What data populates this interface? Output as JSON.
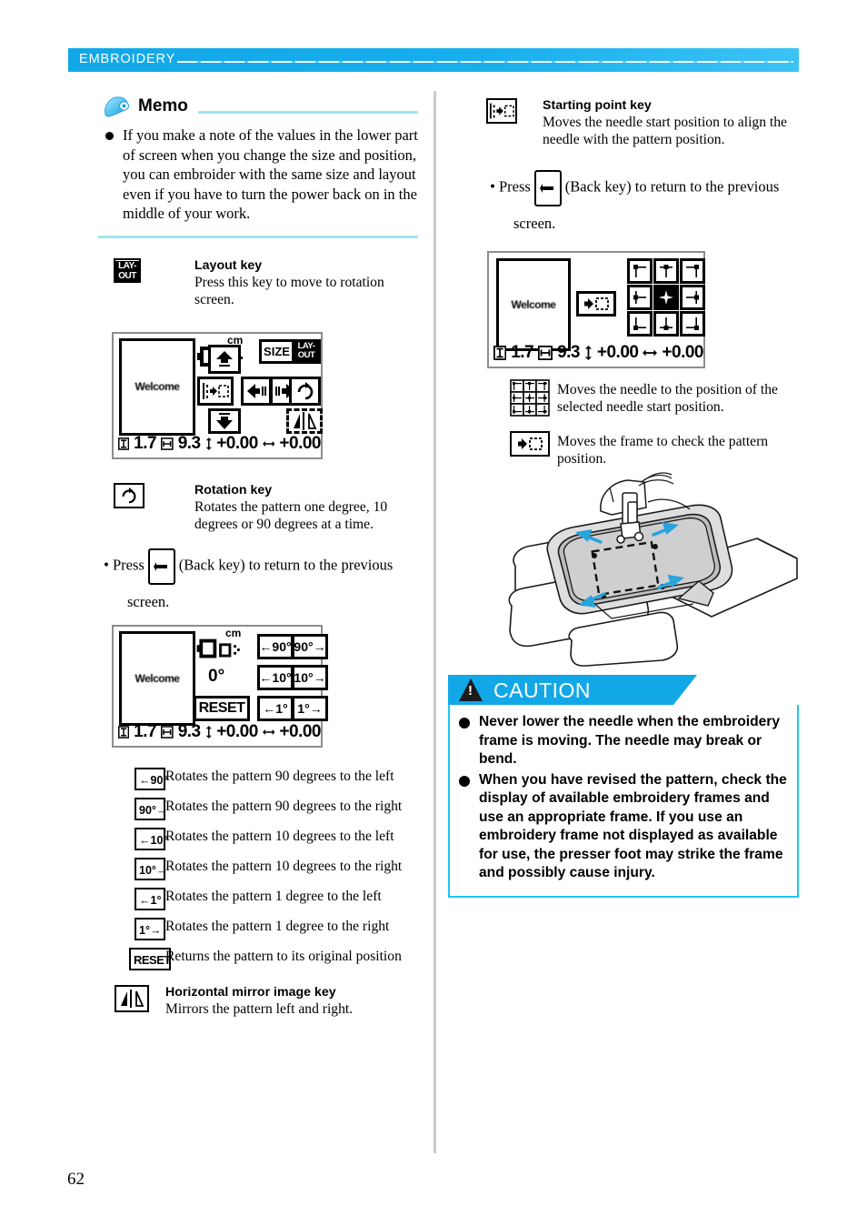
{
  "header": {
    "section_label": "EMBROIDERY",
    "accent_color": "#12A8E8"
  },
  "page_number": "62",
  "left_column": {
    "memo": {
      "title": "Memo",
      "icon": "memo-bell-icon",
      "bullets": [
        "If you make a note of the values in the lower part of screen when you change the size and position, you can embroider with the same size and layout even if you have to turn the power back on in the middle of your work."
      ]
    },
    "layout_key": {
      "icon_label_top": "LAY-",
      "icon_label_bottom": "OUT",
      "title": "Layout key",
      "description": "Press this key to move to rotation screen."
    },
    "lcd_layout_screen": {
      "preview_text": "Welcome",
      "unit_label": "cm",
      "keys": [
        {
          "name": "size-key",
          "label": "SIZE"
        },
        {
          "name": "layout-key",
          "label": "LAY-OUT"
        },
        {
          "name": "up-arrow-key",
          "label": "▲"
        },
        {
          "name": "starting-point-key",
          "label": ""
        },
        {
          "name": "left-arrow-key",
          "label": "◀"
        },
        {
          "name": "right-arrow-key",
          "label": "▶"
        },
        {
          "name": "rotation-key",
          "label": ""
        },
        {
          "name": "down-arrow-key",
          "label": "▼"
        },
        {
          "name": "mirror-key",
          "label": ""
        }
      ],
      "status": {
        "height_value": "1.7",
        "width_value": "9.3",
        "vertical_offset": "+0.00",
        "horizontal_offset": "+0.00"
      }
    },
    "rotation_key": {
      "title": "Rotation key",
      "description": "Rotates the pattern one degree, 10 degrees or 90 degrees at a time."
    },
    "press_back": {
      "before": "Press",
      "icon": "back-key-icon",
      "after": "(Back key) to return to the previous",
      "second_line": "screen."
    },
    "lcd_rotation_screen": {
      "preview_text": "Welcome",
      "unit_label": "cm",
      "angle_value": "0°",
      "reset_label": "RESET",
      "keys": [
        "←90°",
        "90°→",
        "←10°",
        "10°→",
        "←1°",
        "1°→"
      ],
      "status": {
        "height_value": "1.7",
        "width_value": "9.3",
        "vertical_offset": "+0.00",
        "horizontal_offset": "+0.00"
      }
    },
    "rotation_table": [
      {
        "icon_label": "←90°",
        "icon_name": "rotate-left-90-icon",
        "description": "Rotates the pattern 90 degrees to the left"
      },
      {
        "icon_label": "90°→",
        "icon_name": "rotate-right-90-icon",
        "description": "Rotates the pattern 90 degrees to the right"
      },
      {
        "icon_label": "←10°",
        "icon_name": "rotate-left-10-icon",
        "description": "Rotates the pattern 10 degrees to the left"
      },
      {
        "icon_label": "10°→",
        "icon_name": "rotate-right-10-icon",
        "description": "Rotates the pattern 10 degrees to the right"
      },
      {
        "icon_label": "←1°",
        "icon_name": "rotate-left-1-icon",
        "description": "Rotates the pattern 1 degree to the left"
      },
      {
        "icon_label": "1°→",
        "icon_name": "rotate-right-1-icon",
        "description": "Rotates the pattern 1 degree to the right"
      },
      {
        "icon_label": "RESET",
        "icon_name": "reset-icon",
        "description": "Returns the pattern to its original position"
      }
    ],
    "mirror_key": {
      "title": "Horizontal mirror image key",
      "description": "Mirrors the pattern left and right."
    }
  },
  "right_column": {
    "starting_point_key": {
      "title": "Starting point key",
      "description": "Moves the needle start position to align the needle with the pattern position."
    },
    "press_back": {
      "before": "Press",
      "icon": "back-key-icon",
      "after": "(Back key) to return to the previous",
      "second_line": "screen."
    },
    "lcd_start_screen": {
      "preview_text": "Welcome",
      "frame_key_name": "move-frame-key",
      "grid_selected_index": 4,
      "status": {
        "height_value": "1.7",
        "width_value": "9.3",
        "vertical_offset": "+0.00",
        "horizontal_offset": "+0.00"
      }
    },
    "start_table": [
      {
        "icon_name": "nine-position-grid-icon",
        "description": "Moves the needle to the position of the selected needle start position."
      },
      {
        "icon_name": "move-frame-icon",
        "description": "Moves the frame to check the pattern position."
      }
    ],
    "illustration": {
      "name": "embroidery-machine-frame-illustration",
      "arrow_color": "#29A3DC"
    },
    "caution": {
      "label": "CAUTION",
      "symbol": "!",
      "items": [
        "Never lower the needle when the embroidery frame is moving. The needle may break or bend.",
        "When you have revised the pattern, check the display of available embroidery frames and use an appropriate frame. If you use an embroidery frame not displayed as available for use, the presser foot may strike the frame and possibly cause injury."
      ]
    }
  }
}
